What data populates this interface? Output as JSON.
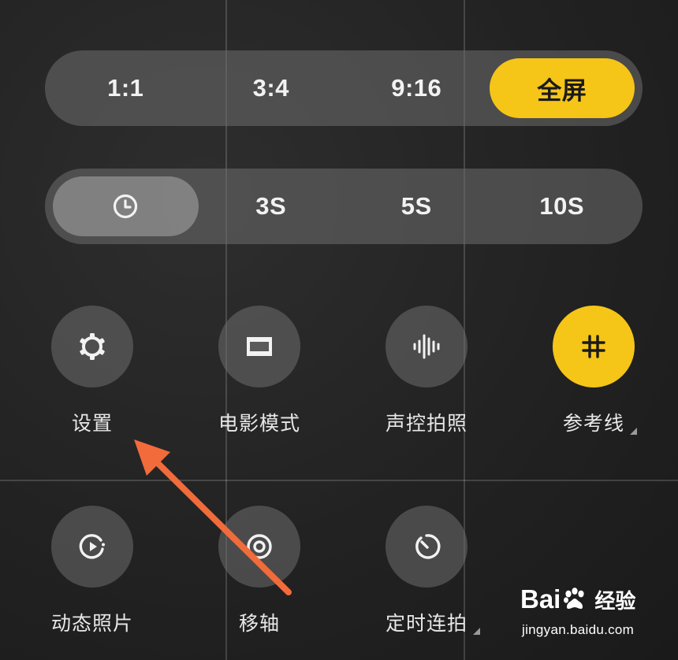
{
  "aspect_ratio": {
    "options": [
      "1:1",
      "3:4",
      "9:16",
      "全屏"
    ],
    "selected": "全屏"
  },
  "timer": {
    "off_icon": "clock-icon",
    "options": [
      "3S",
      "5S",
      "10S"
    ],
    "selected": "off"
  },
  "features_row1": [
    {
      "label": "设置",
      "icon": "gear-icon"
    },
    {
      "label": "电影模式",
      "icon": "widescreen-icon"
    },
    {
      "label": "声控拍照",
      "icon": "soundwave-icon"
    },
    {
      "label": "参考线",
      "icon": "grid-icon",
      "active": true
    }
  ],
  "features_row2": [
    {
      "label": "动态照片",
      "icon": "live-photo-icon"
    },
    {
      "label": "移轴",
      "icon": "tilt-shift-icon"
    },
    {
      "label": "定时连拍",
      "icon": "timer-burst-icon"
    }
  ],
  "colors": {
    "accent": "#f5c518",
    "annotation_arrow": "#f26b3a"
  },
  "watermark": {
    "brand": "Bai",
    "brand_tail": "经验",
    "url": "jingyan.baidu.com"
  }
}
